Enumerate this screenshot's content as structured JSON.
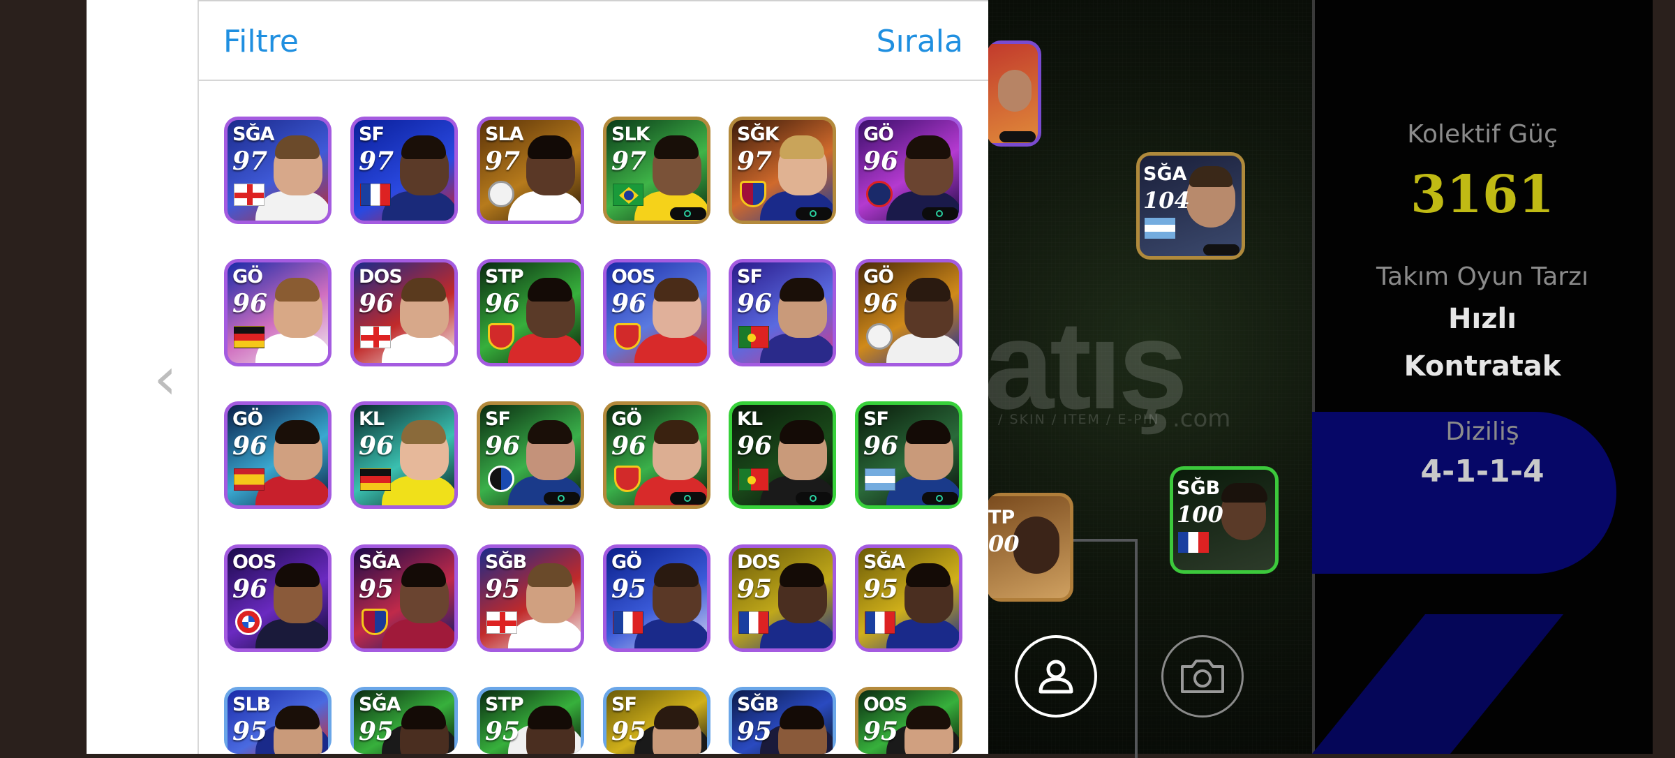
{
  "header": {
    "filter_label": "Filtre",
    "sort_label": "Sırala"
  },
  "nav": {
    "prev_arrow": "‹"
  },
  "team_info": {
    "collective_power_label": "Kolektif Güç",
    "collective_power_value": "3161",
    "play_style_label": "Takım Oyun Tarzı",
    "play_style_value_line1": "Hızlı",
    "play_style_value_line2": "Kontratak",
    "formation_label": "Diziliş",
    "formation_value": "4-1-1-4"
  },
  "watermark": {
    "main": "atış",
    "sub": "/ SKIN / ITEM / E-PIN",
    "domain": ".com"
  },
  "pitch_cards": [
    {
      "pos": "SĞA",
      "rating": "104"
    },
    {
      "pos": "SĞB",
      "rating": "100"
    },
    {
      "pos": "TP",
      "rating": "00"
    }
  ],
  "buttons": {
    "profile_icon": "user-icon",
    "camera_icon": "camera-icon"
  },
  "players": [
    {
      "pos": "SĞA",
      "rating": "97",
      "badge": "flag-england"
    },
    {
      "pos": "SF",
      "rating": "97",
      "badge": "flag-france"
    },
    {
      "pos": "SLA",
      "rating": "97",
      "badge": "crest-madrid"
    },
    {
      "pos": "SLK",
      "rating": "97",
      "badge": "flag-brazil"
    },
    {
      "pos": "SĞK",
      "rating": "97",
      "badge": "crest-barcelona"
    },
    {
      "pos": "GÖ",
      "rating": "96",
      "badge": "crest-psg"
    },
    {
      "pos": "GÖ",
      "rating": "96",
      "badge": "flag-germany"
    },
    {
      "pos": "DOS",
      "rating": "96",
      "badge": "flag-england"
    },
    {
      "pos": "STP",
      "rating": "96",
      "badge": "crest-arsenal"
    },
    {
      "pos": "OOS",
      "rating": "96",
      "badge": "crest-arsenal"
    },
    {
      "pos": "SF",
      "rating": "96",
      "badge": "flag-portugal"
    },
    {
      "pos": "GÖ",
      "rating": "96",
      "badge": "crest-madrid"
    },
    {
      "pos": "GÖ",
      "rating": "96",
      "badge": "flag-spain"
    },
    {
      "pos": "KL",
      "rating": "96",
      "badge": "flag-germany"
    },
    {
      "pos": "SF",
      "rating": "96",
      "badge": "crest-atalanta"
    },
    {
      "pos": "GÖ",
      "rating": "96",
      "badge": "crest-arsenal"
    },
    {
      "pos": "KL",
      "rating": "96",
      "badge": "flag-portugal"
    },
    {
      "pos": "SF",
      "rating": "96",
      "badge": "flag-argentina"
    },
    {
      "pos": "OOS",
      "rating": "96",
      "badge": "crest-bayern"
    },
    {
      "pos": "SĞA",
      "rating": "95",
      "badge": "crest-barcelona"
    },
    {
      "pos": "SĞB",
      "rating": "95",
      "badge": "flag-england"
    },
    {
      "pos": "GÖ",
      "rating": "95",
      "badge": "flag-france"
    },
    {
      "pos": "DOS",
      "rating": "95",
      "badge": "flag-france"
    },
    {
      "pos": "SĞA",
      "rating": "95",
      "badge": "flag-france"
    },
    {
      "pos": "SLB",
      "rating": "95",
      "badge": "none"
    },
    {
      "pos": "SĞA",
      "rating": "95",
      "badge": "none"
    },
    {
      "pos": "STP",
      "rating": "95",
      "badge": "none"
    },
    {
      "pos": "SF",
      "rating": "95",
      "badge": "none"
    },
    {
      "pos": "SĞB",
      "rating": "95",
      "badge": "none"
    },
    {
      "pos": "OOS",
      "rating": "95",
      "badge": "none"
    }
  ]
}
